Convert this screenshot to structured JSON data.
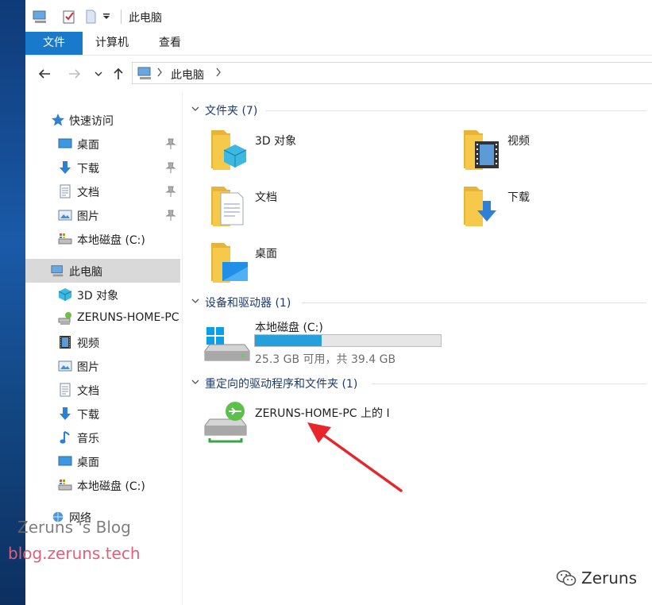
{
  "title_bar": {
    "title": "此电脑"
  },
  "ribbon": {
    "tabs": [
      "文件",
      "计算机",
      "查看"
    ]
  },
  "address_bar": {
    "path": "此电脑"
  },
  "nav_pane": {
    "quick_access": "快速访问",
    "quick_items": [
      "桌面",
      "下载",
      "文档",
      "图片",
      "本地磁盘 (C:)"
    ],
    "this_pc": "此电脑",
    "pc_items": [
      "3D 对象",
      "ZERUNS-HOME-PC",
      "视频",
      "图片",
      "文档",
      "下载",
      "音乐",
      "桌面",
      "本地磁盘 (C:)"
    ],
    "network": "网络"
  },
  "content": {
    "folders_header": "文件夹 (7)",
    "folders": [
      "3D 对象",
      "视频",
      "文档",
      "下载",
      "桌面"
    ],
    "devices_header": "设备和驱动器 (1)",
    "drive": {
      "name": "本地磁盘 (C:)",
      "info": "25.3 GB 可用，共 39.4 GB",
      "used_fraction": 0.36
    },
    "redirect_header": "重定向的驱动程序和文件夹 (1)",
    "redirect_item": "ZERUNS-HOME-PC 上的 I"
  },
  "watermarks": {
    "blog_name": "Zeruns 's Blog",
    "blog_url": "blog.zeruns.tech",
    "wechat": "Zeruns"
  },
  "colors": {
    "accent": "#1979ca",
    "drive_fill": "#26a0da",
    "arrow": "#e8252b",
    "folder": "#f7c94a"
  }
}
